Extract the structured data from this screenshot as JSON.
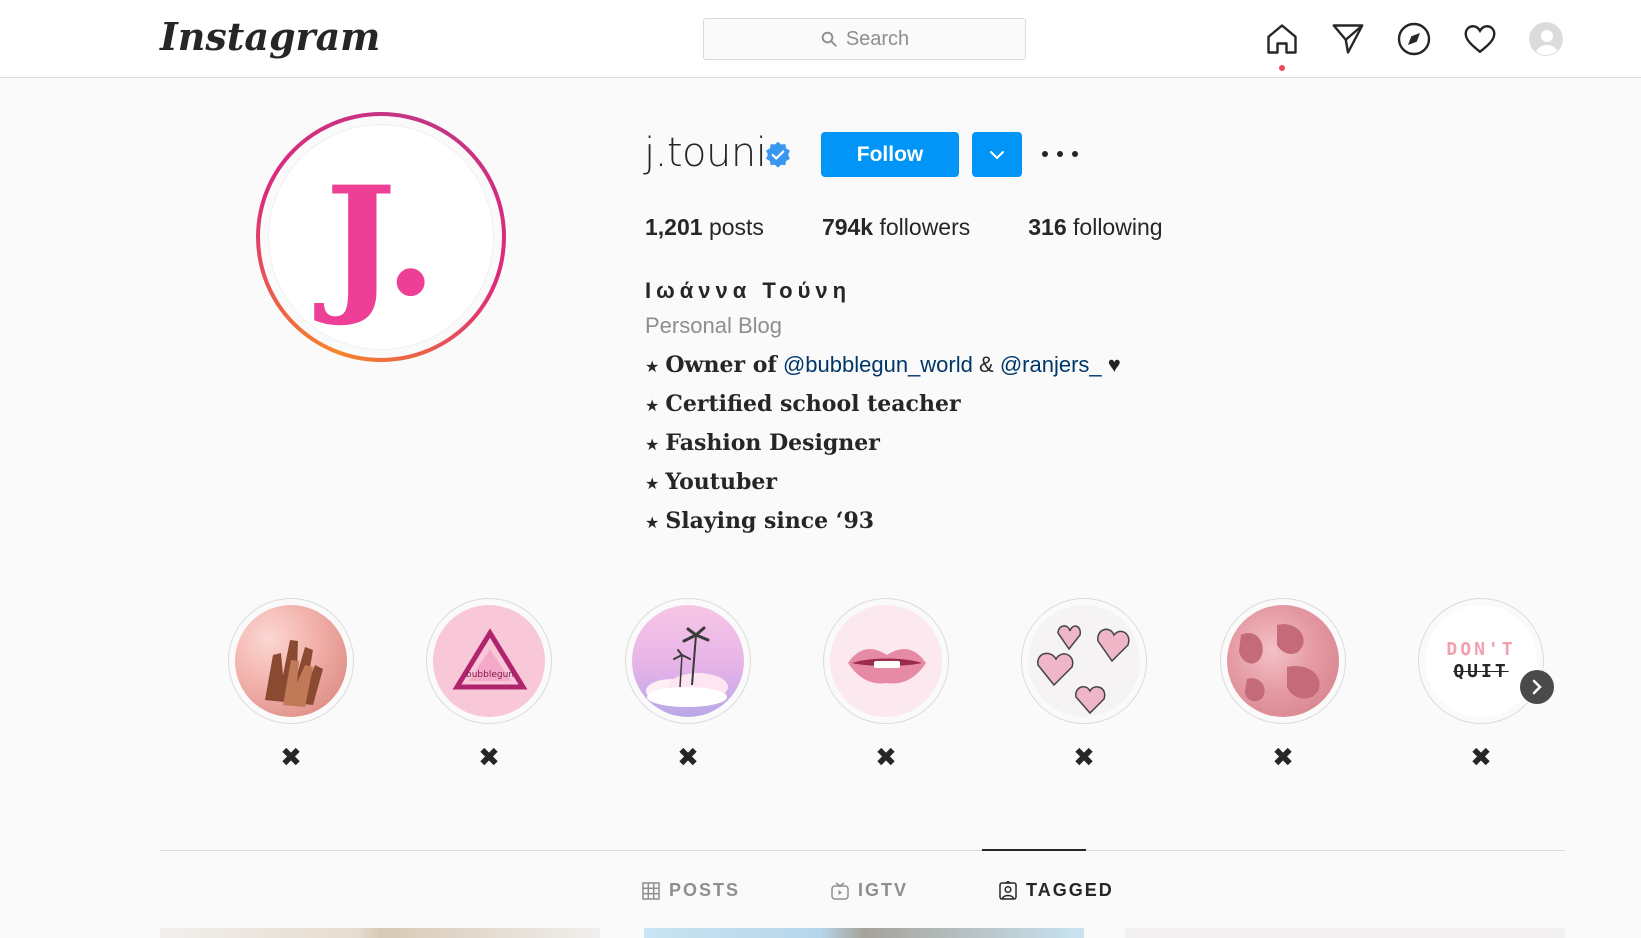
{
  "app": {
    "logo_text": "Instagram",
    "search_placeholder": "Search"
  },
  "nav": {
    "items": [
      "home-icon",
      "direct-icon",
      "explore-icon",
      "activity-heart-icon",
      "profile-avatar-icon"
    ],
    "active": "home"
  },
  "profile": {
    "username": "j.touni",
    "verified": true,
    "avatar_letter": "J.",
    "follow_label": "Follow",
    "stats": {
      "posts_count": "1,201",
      "posts_label": "posts",
      "followers_count": "794k",
      "followers_label": "followers",
      "following_count": "316",
      "following_label": "following"
    },
    "full_name": "Ιωάννα Τούνη",
    "category": "Personal Blog",
    "bio": {
      "line1_prefix": "Owner of",
      "mention1": "@bubblegun_world",
      "amp": "&",
      "mention2": "@ranjers_",
      "heart": "♥",
      "line2": "Certified school teacher",
      "line3": "Fashion Designer",
      "line4": "Youtuber",
      "line5": "Slaying since ‘93"
    }
  },
  "highlights": [
    {
      "label": "✖",
      "theme": "pink-hands"
    },
    {
      "label": "✖",
      "theme": "bubblegun-logo"
    },
    {
      "label": "✖",
      "theme": "palm-cloud"
    },
    {
      "label": "✖",
      "theme": "lips"
    },
    {
      "label": "✖",
      "theme": "hearts"
    },
    {
      "label": "✖",
      "theme": "pink-map"
    },
    {
      "label": "✖",
      "theme": "dont-quit",
      "text_top": "DON'T",
      "text_bottom": "QUIT"
    }
  ],
  "tabs": [
    {
      "label": "POSTS",
      "icon": "grid-icon",
      "active": false
    },
    {
      "label": "IGTV",
      "icon": "igtv-icon",
      "active": false
    },
    {
      "label": "TAGGED",
      "icon": "tagged-icon",
      "active": true
    }
  ],
  "colors": {
    "accent": "#0095f6",
    "avatar_letter": "#ec3f95",
    "mention": "#00376b",
    "notification_dot": "#ed4956"
  }
}
